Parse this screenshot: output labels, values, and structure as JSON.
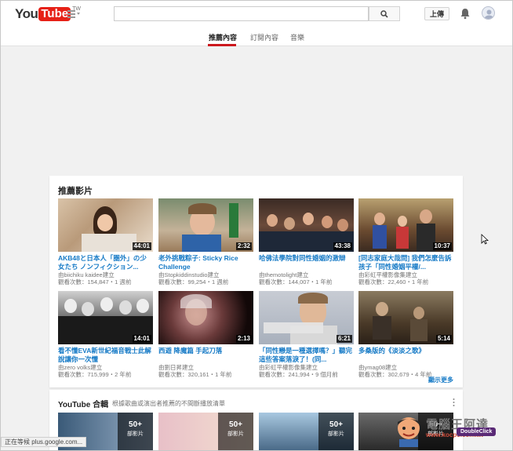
{
  "header": {
    "logo_you": "You",
    "logo_tube": "Tube",
    "logo_region": "TW",
    "search_placeholder": "",
    "upload_label": "上傳"
  },
  "tabs": [
    {
      "label": "推薦內容",
      "active": true
    },
    {
      "label": "訂閱內容",
      "active": false
    },
    {
      "label": "音樂",
      "active": false
    }
  ],
  "recommended": {
    "title": "推薦影片",
    "show_more": "顯示更多",
    "videos": [
      {
        "title": "AKB48と日本人「圏外」の少女たち ノンフィクション...",
        "channel": "由biichiku kaidee建立",
        "meta": "觀看次數：154,847・1 週前",
        "duration": "44:01"
      },
      {
        "title": "老外挑戰粽子: Sticky Rice Challenge",
        "channel": "由Stopkiddinstudio建立",
        "meta": "觀看次數：99,254・1 週前",
        "duration": "2:32"
      },
      {
        "title": "哈佛法學院對同性婚姻的激辯",
        "channel": "由themotolight建立",
        "meta": "觀看次數：144,007・1 年前",
        "duration": "43:38"
      },
      {
        "title": "[同志家庭大哉問] 我們怎麼告訴孩子「同性婚姻平權/...",
        "channel": "由彩虹平權影像集建立",
        "meta": "觀看次數：22,460・1 年前",
        "duration": "10:37"
      },
      {
        "title": "看不懂EVA新世紀福音戰士此解說讓你一次懂",
        "channel": "由zero volks建立",
        "meta": "觀看次數：715,999・2 年前",
        "duration": "14:01"
      },
      {
        "title": "西遊 降魔篇 手起刀落",
        "channel": "由劉日昇建立",
        "meta": "觀看次數：320,161・1 年前",
        "duration": "2:13"
      },
      {
        "title": "「同性戀是一種選擇嗎？」聽完這些答案落淚了！(同...",
        "channel": "由彩虹平權影像集建立",
        "meta": "觀看次數：241,994・9 個月前",
        "duration": "6:21"
      },
      {
        "title": "多桑版的《淡淡之歌》",
        "channel": "由ymag08建立",
        "meta": "觀看次數：302,679・4 年前",
        "duration": "5:14"
      }
    ]
  },
  "mix": {
    "title": "YouTube 合輯",
    "subtitle": "根據歌曲或演出者推薦的不間斷播放清單",
    "items": [
      {
        "count": "50+",
        "unit": "部影片"
      },
      {
        "count": "50+",
        "unit": "部影片"
      },
      {
        "count": "50+",
        "unit": "部影片"
      },
      {
        "count": "50+",
        "unit": "部影片"
      }
    ]
  },
  "statusbar": {
    "text": "正在等候 plus.google.com..."
  },
  "watermark": {
    "text": "電腦王阿達",
    "url": "www.kocpc.com.tw",
    "badge": "DoubleClick"
  },
  "colors": {
    "brand_red": "#e62117",
    "link_blue": "#167ac6",
    "tab_active_underline": "#cc181e"
  }
}
